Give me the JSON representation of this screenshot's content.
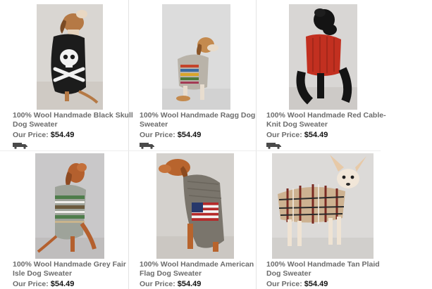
{
  "products": [
    {
      "title": "100% Wool Handmade Black Skull Dog Sweater",
      "price_label": "Our Price:",
      "price": "$54.49",
      "shipping_icon": "truck-icon"
    },
    {
      "title": "100% Wool Handmade Ragg Dog Sweater",
      "price_label": "Our Price:",
      "price": "$54.49",
      "shipping_icon": "truck-icon"
    },
    {
      "title": "100% Wool Handmade Red Cable-Knit Dog Sweater",
      "price_label": "Our Price:",
      "price": "$54.49",
      "shipping_icon": "truck-icon"
    },
    {
      "title": "100% Wool Handmade Grey Fair Isle Dog Sweater",
      "price_label": "Our Price:",
      "price": "$54.49"
    },
    {
      "title": "100% Wool Handmade American Flag Dog Sweater",
      "price_label": "Our Price:",
      "price": "$54.49"
    },
    {
      "title": "100% Wool Handmade Tan Plaid Dog Sweater",
      "price_label": "Our Price:",
      "price": "$54.49"
    }
  ],
  "colors": {
    "title_text": "#6c6c6c",
    "price_text": "#111111",
    "divider": "#e3e3e3"
  }
}
